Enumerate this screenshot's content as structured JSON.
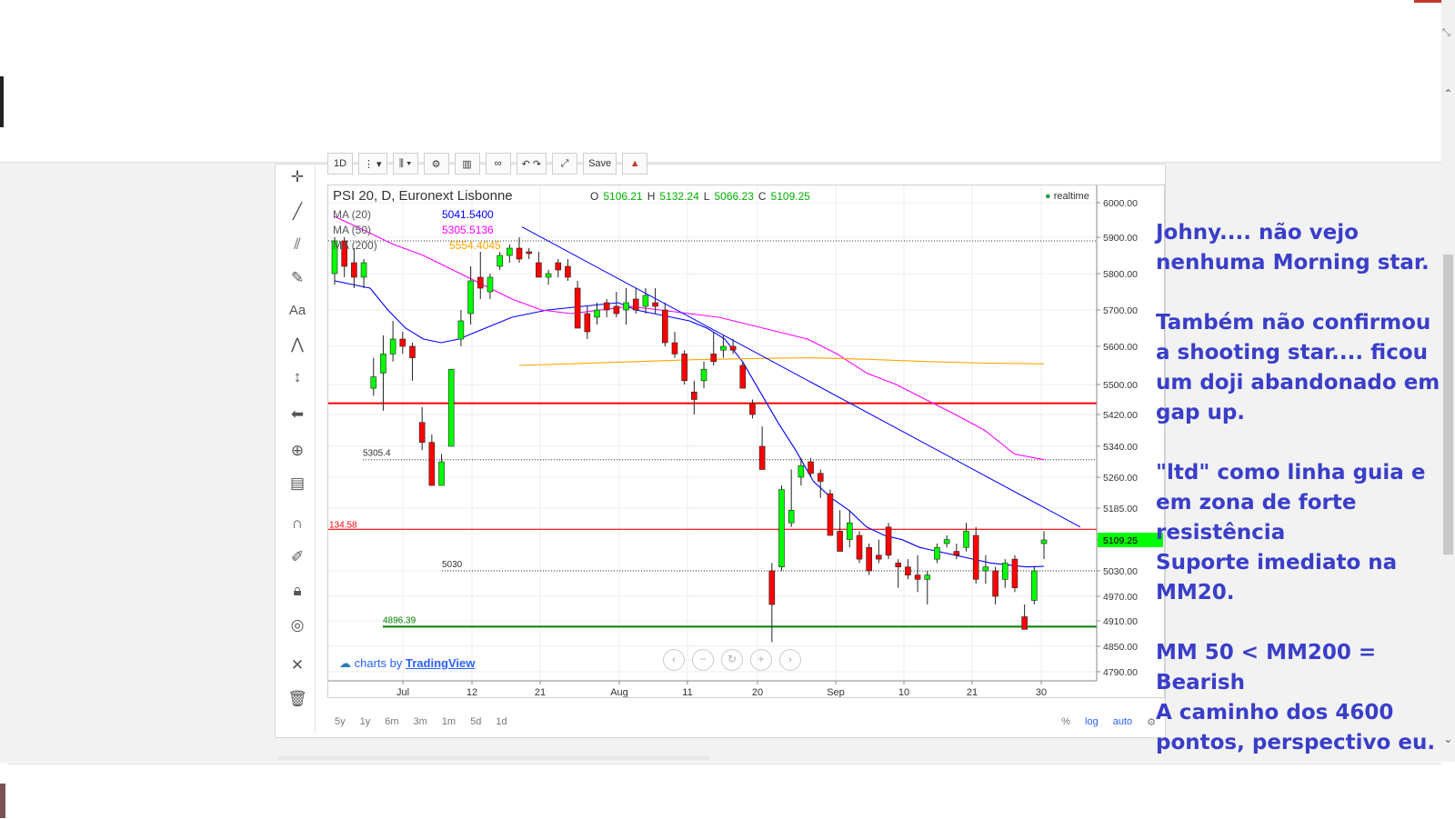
{
  "chart_header": {
    "symbol": "PSI 20, D, Euronext Lisbonne",
    "o_label": "O",
    "o_value": "5106.21",
    "h_label": "H",
    "h_value": "5132.24",
    "l_label": "L",
    "l_value": "5066.23",
    "c_label": "C",
    "c_value": "5109.25",
    "realtime": "realtime"
  },
  "indicators": [
    {
      "name": "MA (20)",
      "value": "5041.5400",
      "color": "#0000ff"
    },
    {
      "name": "MA (50)",
      "value": "5305.5136",
      "color": "#ff00ff"
    },
    {
      "name": "MA (200)",
      "value": "5554.4045",
      "color": "#ffa500"
    }
  ],
  "toolbar": {
    "interval": "1D",
    "save": "Save"
  },
  "time_ranges": [
    "5y",
    "1y",
    "6m",
    "3m",
    "1m",
    "5d",
    "1d"
  ],
  "bottom_right": {
    "percent": "%",
    "log": "log",
    "auto": "auto"
  },
  "attribution": {
    "prefix": "charts by",
    "brand": "TradingView"
  },
  "colors": {
    "up": "#00ff00",
    "down": "#ff0000",
    "note_text": "#3a3ec8"
  },
  "notes": [
    "Johny.... não vejo nenhuma Morning star.",
    "Também não confirmou a shooting star.... ficou um doji abandonado em gap up.",
    "\"ltd\" como linha guia e em zona de forte resistência",
    "Suporte imediato na MM20.",
    "MM 50 < MM200 = Bearish",
    "A caminho dos 4600 pontos, perspectivo eu."
  ],
  "chart_data": {
    "type": "candlestick",
    "title": "PSI 20, D, Euronext Lisbonne",
    "y_ticks": [
      6000,
      5900,
      5800,
      5700,
      5600,
      5500,
      5420,
      5340,
      5260,
      5185,
      5109.25,
      5030,
      4970,
      4910,
      4850,
      4790
    ],
    "y_tick_labels": [
      "6000.00",
      "5900.00",
      "5800.00",
      "5700.00",
      "5600.00",
      "5500.00",
      "5420.00",
      "5340.00",
      "5260.00",
      "5185.00",
      "5109.25",
      "5030.00",
      "4970.00",
      "4910.00",
      "4850.00",
      "4790.00"
    ],
    "x_tick_labels": [
      "Jul",
      "12",
      "21",
      "Aug",
      "11",
      "20",
      "Sep",
      "10",
      "21",
      "30"
    ],
    "price_labels": {
      "current": "5109.25",
      "red_line": "5134.58",
      "red_line_short": "134.58",
      "dotted_1": "5305.4",
      "dotted_2": "5030",
      "green_support": "4896.39"
    },
    "horizontal_lines": [
      {
        "value": 5134.58,
        "color": "#ff0000",
        "style": "solid"
      },
      {
        "value": 5450,
        "color": "#ff0000",
        "style": "solid-thick"
      },
      {
        "value": 4896.39,
        "color": "#008000",
        "style": "solid"
      },
      {
        "value": 5305.4,
        "color": "#333333",
        "style": "dotted"
      },
      {
        "value": 5030,
        "color": "#333333",
        "style": "dotted"
      },
      {
        "value": 5890,
        "color": "#333333",
        "style": "dotted"
      }
    ],
    "candles": [
      {
        "o": 5800,
        "h": 5900,
        "l": 5770,
        "c": 5890
      },
      {
        "o": 5890,
        "h": 5900,
        "l": 5790,
        "c": 5820
      },
      {
        "o": 5830,
        "h": 5870,
        "l": 5760,
        "c": 5790
      },
      {
        "o": 5790,
        "h": 5840,
        "l": 5760,
        "c": 5830
      },
      {
        "o": 5490,
        "h": 5570,
        "l": 5470,
        "c": 5520
      },
      {
        "o": 5530,
        "h": 5630,
        "l": 5430,
        "c": 5580
      },
      {
        "o": 5580,
        "h": 5670,
        "l": 5560,
        "c": 5620
      },
      {
        "o": 5620,
        "h": 5640,
        "l": 5580,
        "c": 5600
      },
      {
        "o": 5600,
        "h": 5610,
        "l": 5510,
        "c": 5570
      },
      {
        "o": 5400,
        "h": 5440,
        "l": 5330,
        "c": 5350
      },
      {
        "o": 5350,
        "h": 5370,
        "l": 5240,
        "c": 5240
      },
      {
        "o": 5240,
        "h": 5320,
        "l": 5240,
        "c": 5300
      },
      {
        "o": 5340,
        "h": 5540,
        "l": 5340,
        "c": 5540
      },
      {
        "o": 5620,
        "h": 5700,
        "l": 5600,
        "c": 5670
      },
      {
        "o": 5690,
        "h": 5820,
        "l": 5660,
        "c": 5780
      },
      {
        "o": 5790,
        "h": 5860,
        "l": 5730,
        "c": 5760
      },
      {
        "o": 5750,
        "h": 5800,
        "l": 5730,
        "c": 5790
      },
      {
        "o": 5820,
        "h": 5860,
        "l": 5810,
        "c": 5850
      },
      {
        "o": 5850,
        "h": 5880,
        "l": 5830,
        "c": 5870
      },
      {
        "o": 5870,
        "h": 5900,
        "l": 5830,
        "c": 5840
      },
      {
        "o": 5860,
        "h": 5870,
        "l": 5840,
        "c": 5855
      },
      {
        "o": 5830,
        "h": 5860,
        "l": 5800,
        "c": 5790
      },
      {
        "o": 5790,
        "h": 5810,
        "l": 5770,
        "c": 5800
      },
      {
        "o": 5830,
        "h": 5840,
        "l": 5790,
        "c": 5810
      },
      {
        "o": 5820,
        "h": 5840,
        "l": 5780,
        "c": 5790
      },
      {
        "o": 5760,
        "h": 5780,
        "l": 5650,
        "c": 5650
      },
      {
        "o": 5690,
        "h": 5710,
        "l": 5620,
        "c": 5640
      },
      {
        "o": 5680,
        "h": 5720,
        "l": 5660,
        "c": 5700
      },
      {
        "o": 5720,
        "h": 5730,
        "l": 5680,
        "c": 5700
      },
      {
        "o": 5710,
        "h": 5750,
        "l": 5680,
        "c": 5690
      },
      {
        "o": 5700,
        "h": 5760,
        "l": 5660,
        "c": 5720
      },
      {
        "o": 5730,
        "h": 5760,
        "l": 5690,
        "c": 5700
      },
      {
        "o": 5710,
        "h": 5760,
        "l": 5690,
        "c": 5740
      },
      {
        "o": 5720,
        "h": 5760,
        "l": 5690,
        "c": 5710
      },
      {
        "o": 5700,
        "h": 5720,
        "l": 5600,
        "c": 5610
      },
      {
        "o": 5610,
        "h": 5640,
        "l": 5570,
        "c": 5580
      },
      {
        "o": 5580,
        "h": 5590,
        "l": 5500,
        "c": 5510
      },
      {
        "o": 5480,
        "h": 5510,
        "l": 5420,
        "c": 5460
      },
      {
        "o": 5510,
        "h": 5560,
        "l": 5490,
        "c": 5540
      },
      {
        "o": 5580,
        "h": 5640,
        "l": 5550,
        "c": 5560
      },
      {
        "o": 5590,
        "h": 5630,
        "l": 5570,
        "c": 5600
      },
      {
        "o": 5600,
        "h": 5620,
        "l": 5580,
        "c": 5590
      },
      {
        "o": 5550,
        "h": 5560,
        "l": 5490,
        "c": 5490
      },
      {
        "o": 5450,
        "h": 5460,
        "l": 5410,
        "c": 5420
      },
      {
        "o": 5340,
        "h": 5390,
        "l": 5280,
        "c": 5280
      },
      {
        "o": 5030,
        "h": 5050,
        "l": 4860,
        "c": 4950
      },
      {
        "o": 5040,
        "h": 5240,
        "l": 5030,
        "c": 5230
      },
      {
        "o": 5150,
        "h": 5280,
        "l": 5140,
        "c": 5180
      },
      {
        "o": 5260,
        "h": 5310,
        "l": 5240,
        "c": 5290
      },
      {
        "o": 5300,
        "h": 5310,
        "l": 5260,
        "c": 5270
      },
      {
        "o": 5270,
        "h": 5280,
        "l": 5210,
        "c": 5250
      },
      {
        "o": 5220,
        "h": 5230,
        "l": 5130,
        "c": 5120
      },
      {
        "o": 5130,
        "h": 5180,
        "l": 5080,
        "c": 5080
      },
      {
        "o": 5110,
        "h": 5180,
        "l": 5090,
        "c": 5150
      },
      {
        "o": 5120,
        "h": 5130,
        "l": 5050,
        "c": 5060
      },
      {
        "o": 5090,
        "h": 5100,
        "l": 5020,
        "c": 5030
      },
      {
        "o": 5070,
        "h": 5110,
        "l": 5050,
        "c": 5060
      },
      {
        "o": 5140,
        "h": 5150,
        "l": 5060,
        "c": 5070
      },
      {
        "o": 5050,
        "h": 5060,
        "l": 4990,
        "c": 5040
      },
      {
        "o": 5040,
        "h": 5060,
        "l": 5010,
        "c": 5020
      },
      {
        "o": 5020,
        "h": 5070,
        "l": 4980,
        "c": 5010
      },
      {
        "o": 5010,
        "h": 5030,
        "l": 4950,
        "c": 5020
      },
      {
        "o": 5060,
        "h": 5100,
        "l": 5050,
        "c": 5090
      },
      {
        "o": 5100,
        "h": 5120,
        "l": 5090,
        "c": 5110
      },
      {
        "o": 5080,
        "h": 5100,
        "l": 5060,
        "c": 5070
      },
      {
        "o": 5090,
        "h": 5150,
        "l": 5080,
        "c": 5130
      },
      {
        "o": 5120,
        "h": 5140,
        "l": 5000,
        "c": 5010
      },
      {
        "o": 5030,
        "h": 5070,
        "l": 5000,
        "c": 5040
      },
      {
        "o": 5030,
        "h": 5040,
        "l": 4950,
        "c": 4970
      },
      {
        "o": 5010,
        "h": 5060,
        "l": 4990,
        "c": 5050
      },
      {
        "o": 5060,
        "h": 5070,
        "l": 4980,
        "c": 4990
      },
      {
        "o": 4920,
        "h": 4950,
        "l": 4890,
        "c": 4890
      },
      {
        "o": 4960,
        "h": 5040,
        "l": 4950,
        "c": 5030
      },
      {
        "o": 5100,
        "h": 5130,
        "l": 5060,
        "c": 5109.25
      }
    ],
    "ma20": [
      5780,
      5770,
      5760,
      5700,
      5650,
      5620,
      5610,
      5620,
      5640,
      5660,
      5680,
      5690,
      5700,
      5705,
      5710,
      5715,
      5720,
      5700,
      5690,
      5680,
      5670,
      5650,
      5620,
      5560,
      5480,
      5400,
      5330,
      5250,
      5210,
      5180,
      5140,
      5120,
      5110,
      5090,
      5080,
      5070,
      5060,
      5050,
      5045,
      5040,
      5041.54
    ],
    "ma50": [
      5960,
      5920,
      5880,
      5850,
      5810,
      5770,
      5730,
      5700,
      5690,
      5700,
      5710,
      5700,
      5690,
      5680,
      5660,
      5640,
      5620,
      5580,
      5530,
      5500,
      5460,
      5420,
      5380,
      5320,
      5305.51
    ],
    "ma200": [
      5550,
      5555,
      5560,
      5565,
      5568,
      5570,
      5566,
      5560,
      5556,
      5554.4
    ]
  }
}
